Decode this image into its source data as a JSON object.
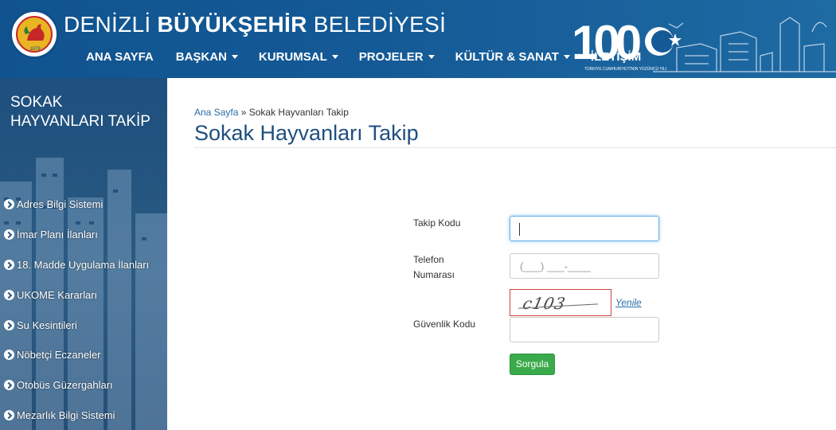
{
  "header": {
    "title_regular": "DENİZLİ ",
    "title_bold": "BÜYÜKŞEHİR",
    "title_regular2": " BELEDİYESİ",
    "logo_text": "1878",
    "centennial_text": "100",
    "centennial_caption": "TÜRKİYE CUMHURİYETİ'NİN YÜZÜNCÜ YILI",
    "nav": [
      {
        "label": "ANA SAYFA",
        "has_dropdown": false
      },
      {
        "label": "BAŞKAN",
        "has_dropdown": true
      },
      {
        "label": "KURUMSAL",
        "has_dropdown": true
      },
      {
        "label": "PROJELER",
        "has_dropdown": true
      },
      {
        "label": "KÜLTÜR & SANAT",
        "has_dropdown": true
      },
      {
        "label": "İLETİŞİM",
        "has_dropdown": false
      }
    ]
  },
  "sidebar": {
    "title": "SOKAK HAYVANLARI TAKİP",
    "items": [
      {
        "label": "Adres Bilgi Sistemi",
        "icon": "chevron-circle-right-icon"
      },
      {
        "label": "İmar Planı İlanları",
        "icon": "chevron-circle-right-icon"
      },
      {
        "label": "18. Madde Uygulama İlanları",
        "icon": "chevron-circle-right-icon"
      },
      {
        "label": "UKOME Kararları",
        "icon": "chevron-circle-right-icon"
      },
      {
        "label": "Su Kesintileri",
        "icon": "chevron-circle-right-icon"
      },
      {
        "label": "Nöbetçi Eczaneler",
        "icon": "chevron-circle-right-icon"
      },
      {
        "label": "Otobüs Güzergahları",
        "icon": "chevron-circle-right-icon"
      },
      {
        "label": "Mezarlık Bilgi Sistemi",
        "icon": "chevron-circle-right-icon"
      }
    ]
  },
  "main": {
    "breadcrumb": {
      "home": "Ana Sayfa",
      "separator": " » ",
      "current": "Sokak Hayvanları Takip"
    },
    "page_title": "Sokak Hayvanları Takip",
    "form": {
      "tracking_label": "Takip Kodu",
      "tracking_value": "",
      "phone_label_line1": "Telefon",
      "phone_label_line2": "Numarası",
      "phone_mask": "(___) ___-____",
      "captcha_label": "Güvenlik Kodu",
      "captcha_text": "c103",
      "refresh_label": "Yenile",
      "captcha_value": "",
      "submit_label": "Sorgula"
    }
  },
  "colors": {
    "header_bg": "#10538f",
    "sidebar_bg": "#23547f",
    "title_blue": "#1f4f7f",
    "submit_green": "#3aaa4a",
    "link_blue": "#2a6ea8"
  }
}
